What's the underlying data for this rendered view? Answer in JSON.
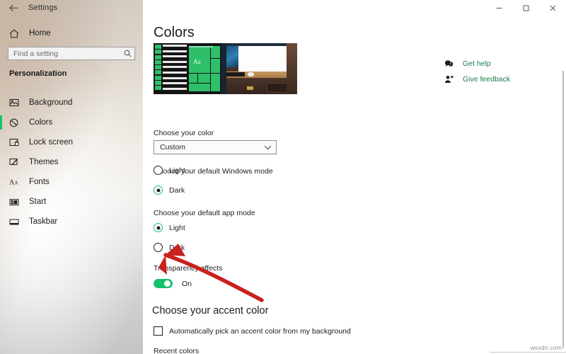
{
  "window": {
    "title": "Settings",
    "back_icon": "back-arrow-icon",
    "minimize_label": "—",
    "maximize_label": "❑",
    "close_label": "✕"
  },
  "sidebar": {
    "home_label": "Home",
    "home_icon": "home-icon",
    "search": {
      "placeholder": "Find a setting",
      "value": "",
      "icon": "search-icon"
    },
    "section_title": "Personalization",
    "items": [
      {
        "label": "Background",
        "icon": "background-picture-icon",
        "selected": false
      },
      {
        "label": "Colors",
        "icon": "colors-palette-icon",
        "selected": true
      },
      {
        "label": "Lock screen",
        "icon": "lock-screen-icon",
        "selected": false
      },
      {
        "label": "Themes",
        "icon": "themes-brush-icon",
        "selected": false
      },
      {
        "label": "Fonts",
        "icon": "fonts-aa-icon",
        "selected": false
      },
      {
        "label": "Start",
        "icon": "start-menu-icon",
        "selected": false
      },
      {
        "label": "Taskbar",
        "icon": "taskbar-icon",
        "selected": false
      }
    ],
    "accent_bar_color": "#13c666"
  },
  "main": {
    "page_title": "Colors",
    "preview_alt": "desktop-color-preview",
    "preview_sample_text": "Aa",
    "choose_color": {
      "label": "Choose your color",
      "selected": "Custom",
      "chevron": "chevron-down-icon"
    },
    "windows_mode": {
      "label": "Choose your default Windows mode",
      "options": [
        {
          "label": "Light",
          "selected": false
        },
        {
          "label": "Dark",
          "selected": true
        }
      ]
    },
    "app_mode": {
      "label": "Choose your default app mode",
      "options": [
        {
          "label": "Light",
          "selected": true
        },
        {
          "label": "Dark",
          "selected": false
        }
      ]
    },
    "transparency": {
      "label": "Transparency effects",
      "state": "On",
      "on": true
    },
    "accent": {
      "heading": "Choose your accent color",
      "auto_pick_label": "Automatically pick an accent color from my background",
      "auto_pick_checked": false,
      "recent_colors_label": "Recent colors"
    }
  },
  "help": {
    "items": [
      {
        "label": "Get help",
        "icon": "get-help-icon"
      },
      {
        "label": "Give feedback",
        "icon": "give-feedback-icon"
      }
    ],
    "link_color": "#1a7a46"
  },
  "annotation": {
    "type": "red-arrow",
    "color": "#c9211e",
    "points_at": "app-mode-dark-radio"
  },
  "watermark": {
    "text": "wsxdn.com"
  }
}
